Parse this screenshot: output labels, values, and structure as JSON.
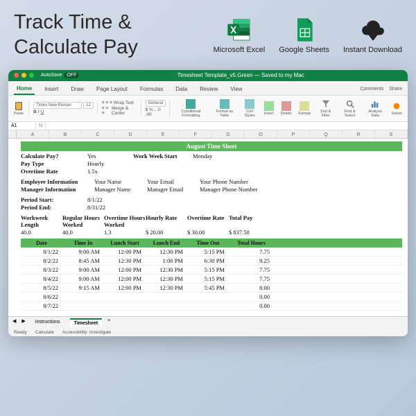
{
  "hero": {
    "title_line1": "Track Time &",
    "title_line2": "Calculate Pay",
    "icons": [
      {
        "label": "Microsoft Excel"
      },
      {
        "label": "Google Sheets"
      },
      {
        "label": "Instant Download"
      }
    ]
  },
  "titlebar": {
    "autosave_label": "AutoSave",
    "autosave_state": "OFF",
    "filename": "Timesheet Template_v5.Green",
    "saved": "— Saved to my Mac"
  },
  "ribbon": {
    "tabs": [
      "Home",
      "Insert",
      "Draw",
      "Page Layout",
      "Formulas",
      "Data",
      "Review",
      "View"
    ],
    "active": "Home",
    "right": [
      "Comments",
      "Share"
    ],
    "font": "Times New Roman",
    "size": "12",
    "wrap": "Wrap Text",
    "merge": "Merge & Center",
    "numfmt": "General",
    "groups": [
      "Conditional Formatting",
      "Format as Table",
      "Cell Styles",
      "Insert",
      "Delete",
      "Format",
      "Sort & Filter",
      "Find & Select",
      "Analyze Data",
      "Solver"
    ]
  },
  "formula": {
    "namebox": "A1",
    "fx": "fx"
  },
  "columns": [
    "A",
    "B",
    "C",
    "D",
    "E",
    "F",
    "G",
    "O",
    "P",
    "Q",
    "R",
    "S"
  ],
  "sheet": {
    "title": "August Time Sheet",
    "config": [
      {
        "label": "Calculate Pay?",
        "v1": "Yes",
        "label2": "Work Week Start",
        "v2": "Monday"
      },
      {
        "label": "Pay Type",
        "v1": "Hourly"
      },
      {
        "label": "Overtime Rate",
        "v1": "1.5x"
      }
    ],
    "emp": {
      "label": "Employee Information",
      "v1": "Your Name",
      "v2": "Your Email",
      "v3": "Your Phone Number"
    },
    "mgr": {
      "label": "Manager Information",
      "v1": "Manager Name",
      "v2": "Manager Email",
      "v3": "Manager Phone Number"
    },
    "period": [
      {
        "label": "Period Start:",
        "val": "8/1/22"
      },
      {
        "label": "Period End:",
        "val": "8/31/22"
      }
    ],
    "summary_headers": [
      "Workweek Length",
      "Regular Hours Worked",
      "Overtime Hours Worked",
      "Hourly Rate",
      "Overtime Rate",
      "Total Pay"
    ],
    "summary_values": [
      "40.0",
      "40.0",
      "1.3",
      "$        20.00",
      "$        30.00",
      "$        837.50"
    ],
    "table_headers": [
      "Date",
      "Time In",
      "Lunch Start",
      "Lunch End",
      "Time Out",
      "Total Hours"
    ],
    "rows": [
      {
        "date": "8/1/22",
        "in": "9:00 AM",
        "ls": "12:00 PM",
        "le": "12:30 PM",
        "out": "5:15 PM",
        "tot": "7.75"
      },
      {
        "date": "8/2/22",
        "in": "8:45 AM",
        "ls": "12:30 PM",
        "le": "1:00 PM",
        "out": "6:30 PM",
        "tot": "9.25"
      },
      {
        "date": "8/3/22",
        "in": "9:00 AM",
        "ls": "12:00 PM",
        "le": "12:30 PM",
        "out": "5:15 PM",
        "tot": "7.75"
      },
      {
        "date": "8/4/22",
        "in": "9:00 AM",
        "ls": "12:00 PM",
        "le": "12:30 PM",
        "out": "5:15 PM",
        "tot": "7.75"
      },
      {
        "date": "8/5/22",
        "in": "9:15 AM",
        "ls": "12:00 PM",
        "le": "12:30 PM",
        "out": "5:45 PM",
        "tot": "8.00"
      },
      {
        "date": "8/6/22",
        "in": "",
        "ls": "",
        "le": "",
        "out": "",
        "tot": "0.00"
      },
      {
        "date": "8/7/22",
        "in": "",
        "ls": "",
        "le": "",
        "out": "",
        "tot": "0.00"
      }
    ]
  },
  "sheettabs": {
    "tabs": [
      "Instructions",
      "Timesheet"
    ],
    "active": "Timesheet"
  },
  "status": {
    "ready": "Ready",
    "calc": "Calculate",
    "access": "Accessibility: Investigate"
  }
}
